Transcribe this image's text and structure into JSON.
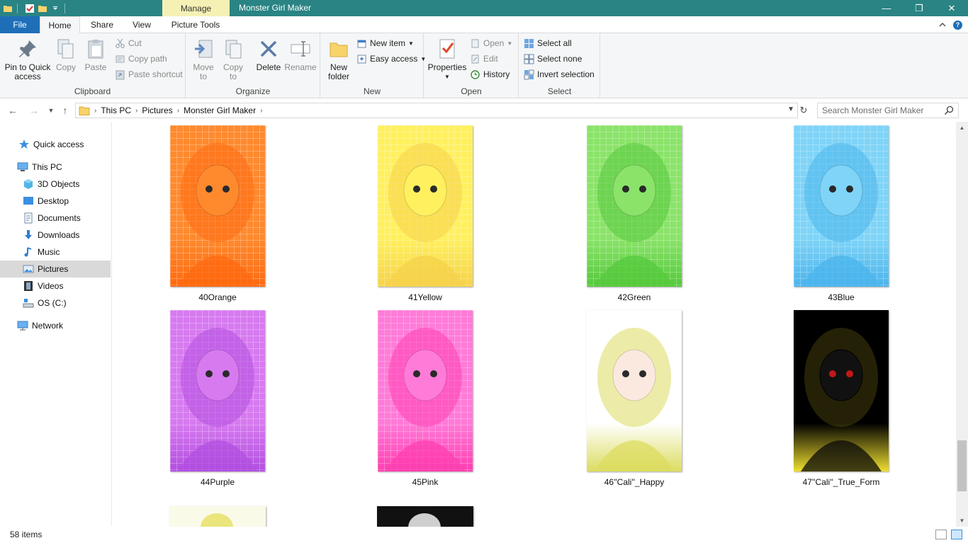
{
  "window": {
    "title": "Monster Girl Maker",
    "context_tab": "Manage",
    "controls": [
      "—",
      "❐",
      "✕"
    ]
  },
  "tabs": {
    "file": "File",
    "home": "Home",
    "share": "Share",
    "view": "View",
    "picture_tools": "Picture Tools"
  },
  "ribbon": {
    "clipboard": {
      "label": "Clipboard",
      "pin_line1": "Pin to Quick",
      "pin_line2": "access",
      "copy": "Copy",
      "paste": "Paste",
      "cut": "Cut",
      "copy_path": "Copy path",
      "paste_shortcut": "Paste shortcut"
    },
    "organize": {
      "label": "Organize",
      "move_line1": "Move",
      "move_line2": "to",
      "copy_line1": "Copy",
      "copy_line2": "to",
      "delete": "Delete",
      "rename": "Rename"
    },
    "new": {
      "label": "New",
      "folder_line1": "New",
      "folder_line2": "folder",
      "new_item": "New item",
      "easy_access": "Easy access"
    },
    "open": {
      "label": "Open",
      "properties": "Properties",
      "open": "Open",
      "edit": "Edit",
      "history": "History"
    },
    "select": {
      "label": "Select",
      "select_all": "Select all",
      "select_none": "Select none",
      "invert": "Invert selection"
    }
  },
  "address": {
    "crumbs": [
      "This PC",
      "Pictures",
      "Monster Girl Maker"
    ],
    "search_placeholder": "Search Monster Girl Maker"
  },
  "nav": {
    "quick_access": "Quick access",
    "this_pc": "This PC",
    "objects_3d": "3D Objects",
    "desktop": "Desktop",
    "documents": "Documents",
    "downloads": "Downloads",
    "music": "Music",
    "pictures": "Pictures",
    "videos": "Videos",
    "os_c": "OS (C:)",
    "network": "Network"
  },
  "files": [
    {
      "name": "40Orange",
      "color": "#ff8a2e",
      "accent": "#ff6a10"
    },
    {
      "name": "41Yellow",
      "color": "#fff060",
      "accent": "#f5d24a"
    },
    {
      "name": "42Green",
      "color": "#8be36a",
      "accent": "#55c93c"
    },
    {
      "name": "43Blue",
      "color": "#7fd4f7",
      "accent": "#4bb4ec"
    },
    {
      "name": "44Purple",
      "color": "#d77af0",
      "accent": "#b24fe0"
    },
    {
      "name": "45Pink",
      "color": "#ff7bd8",
      "accent": "#ff3fb0"
    },
    {
      "name": "46''Cali''_Happy",
      "color": "#ffffff",
      "accent": "#dcdc60"
    },
    {
      "name": "47''Cali''_True_Form",
      "color": "#000000",
      "accent": "#f0e030"
    }
  ],
  "status": {
    "item_count": "58 items"
  }
}
